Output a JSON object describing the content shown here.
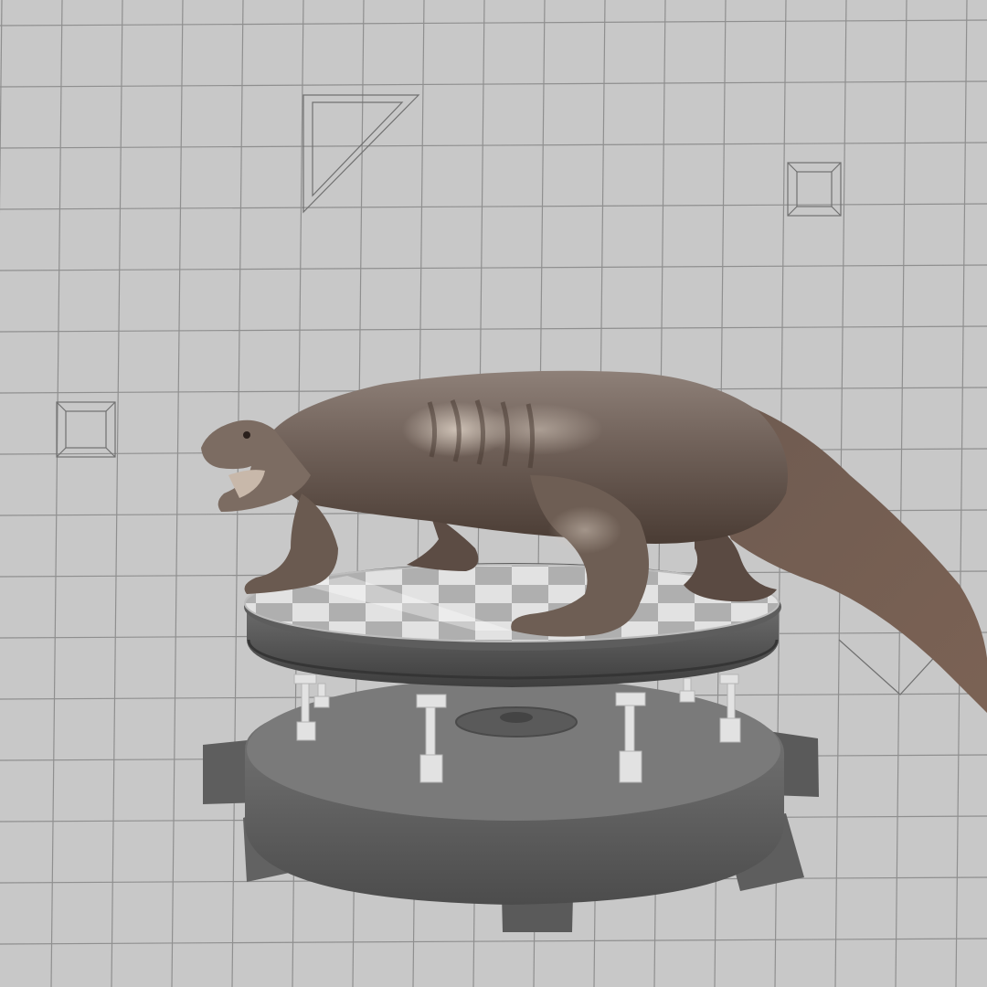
{
  "scene": {
    "background_color": "#c8c8c8",
    "grid_line_color": "#8f8f8f",
    "subject": "reptile-on-turntable",
    "colors": {
      "skin_light": "#a89a8e",
      "skin_mid": "#7a6a5e",
      "skin_dark": "#4a3c34",
      "platform_top": "#d8d8d8",
      "platform_rim": "#5a5a5a",
      "base": "#686868",
      "piston": "#e0e0e0"
    }
  }
}
